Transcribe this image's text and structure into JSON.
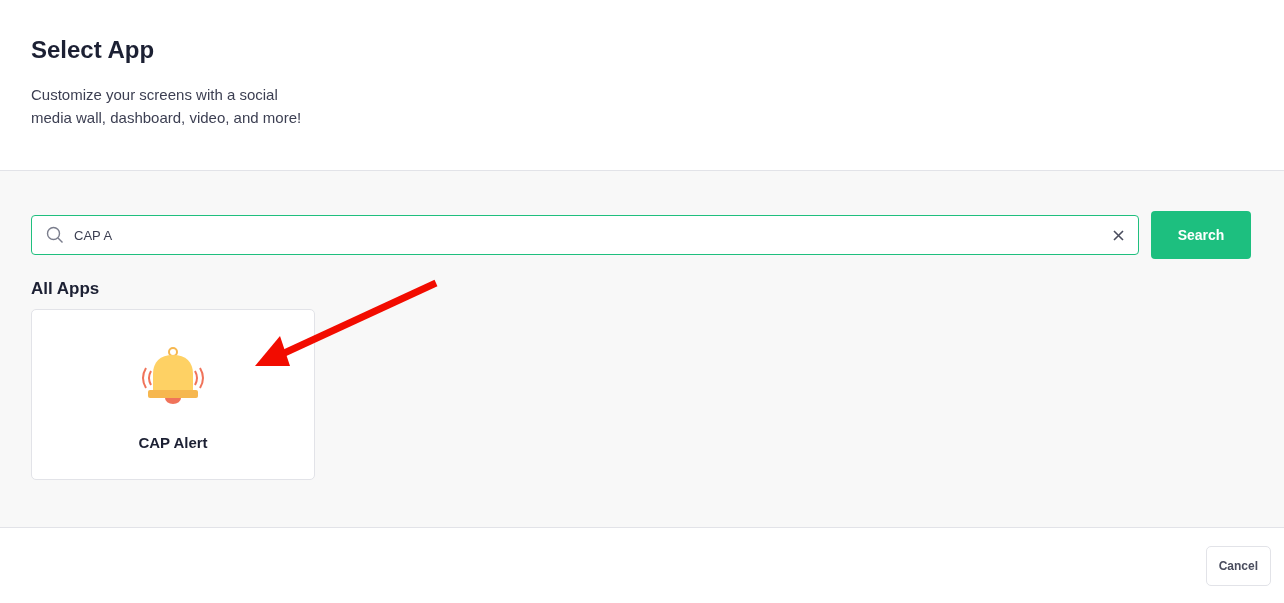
{
  "header": {
    "title": "Select App",
    "description": "Customize your screens with a social media wall, dashboard, video, and more!"
  },
  "search": {
    "value": "CAP A",
    "button": "Search"
  },
  "section_title": "All Apps",
  "apps": [
    {
      "name": "CAP Alert",
      "kind": "alert"
    }
  ],
  "footer": {
    "buttons": [
      "Cancel"
    ]
  }
}
